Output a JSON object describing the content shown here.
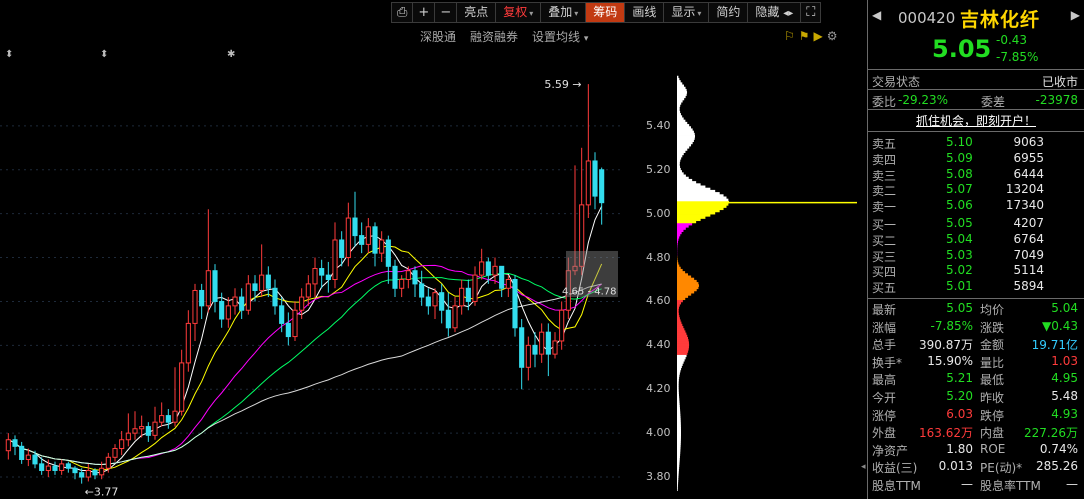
{
  "toolbar": {
    "icons": [
      "lock-icon",
      "plus-icon",
      "minus-icon"
    ],
    "items": [
      {
        "label": "亮点",
        "style": "normal"
      },
      {
        "label": "复权",
        "style": "red",
        "caret": true
      },
      {
        "label": "叠加",
        "style": "normal",
        "caret": true
      },
      {
        "label": "筹码",
        "style": "active"
      },
      {
        "label": "画线",
        "style": "normal"
      },
      {
        "label": "显示",
        "style": "normal",
        "caret": true
      },
      {
        "label": "简约",
        "style": "normal"
      },
      {
        "label": "隐藏",
        "style": "normal"
      }
    ],
    "hide_arrow": "◂▸",
    "fullscreen_icon": "⛶"
  },
  "subbar": {
    "items": [
      "深股通",
      "融资融券",
      "设置均线"
    ],
    "caret": "▾"
  },
  "markers": {
    "glyphs": [
      "⬍",
      "⬍",
      "✱"
    ]
  },
  "chart": {
    "price_ticks": [
      "5.40",
      "5.20",
      "5.00",
      "4.80",
      "4.60",
      "4.40",
      "4.20",
      "4.00",
      "3.80"
    ],
    "high_label": "5.59",
    "low_label": "3.77",
    "cost_label": "4.65 - 4.78",
    "colors": {
      "up": "#ff3b3b",
      "down": "#33ddee",
      "ma5": "#ffffff",
      "ma10": "#ffff00",
      "ma20": "#ff00ff",
      "ma30": "#00ff66",
      "ma60": "#ffffff"
    }
  },
  "chart_data": {
    "type": "candlestick",
    "ylim": [
      3.7,
      5.7
    ],
    "y_ticks": [
      3.8,
      4.0,
      4.2,
      4.4,
      4.6,
      4.8,
      5.0,
      5.2,
      5.4
    ],
    "candles": [
      [
        3.92,
        3.97,
        3.88,
        4.0
      ],
      [
        3.97,
        3.94,
        3.9,
        3.99
      ],
      [
        3.94,
        3.88,
        3.86,
        3.96
      ],
      [
        3.88,
        3.9,
        3.85,
        3.93
      ],
      [
        3.9,
        3.86,
        3.84,
        3.92
      ],
      [
        3.86,
        3.83,
        3.81,
        3.89
      ],
      [
        3.83,
        3.85,
        3.8,
        3.88
      ],
      [
        3.85,
        3.83,
        3.81,
        3.87
      ],
      [
        3.83,
        3.86,
        3.81,
        3.88
      ],
      [
        3.86,
        3.84,
        3.82,
        3.87
      ],
      [
        3.84,
        3.82,
        3.79,
        3.85
      ],
      [
        3.82,
        3.8,
        3.77,
        3.84
      ],
      [
        3.8,
        3.83,
        3.78,
        3.86
      ],
      [
        3.83,
        3.81,
        3.79,
        3.84
      ],
      [
        3.81,
        3.84,
        3.79,
        3.87
      ],
      [
        3.84,
        3.89,
        3.82,
        3.91
      ],
      [
        3.89,
        3.93,
        3.87,
        3.95
      ],
      [
        3.93,
        3.97,
        3.9,
        4.01
      ],
      [
        3.97,
        4.0,
        3.94,
        4.09
      ],
      [
        4.0,
        4.02,
        3.97,
        4.1
      ],
      [
        4.02,
        4.03,
        3.98,
        4.08
      ],
      [
        4.03,
        3.99,
        3.96,
        4.05
      ],
      [
        3.99,
        4.05,
        3.97,
        4.12
      ],
      [
        4.05,
        4.08,
        4.03,
        4.14
      ],
      [
        4.08,
        4.05,
        4.02,
        4.11
      ],
      [
        4.05,
        4.1,
        4.03,
        4.3
      ],
      [
        4.1,
        4.32,
        4.08,
        4.38
      ],
      [
        4.32,
        4.5,
        4.28,
        4.56
      ],
      [
        4.5,
        4.65,
        4.42,
        4.68
      ],
      [
        4.65,
        4.58,
        4.52,
        4.68
      ],
      [
        4.58,
        4.74,
        4.55,
        5.02
      ],
      [
        4.74,
        4.6,
        4.55,
        4.77
      ],
      [
        4.6,
        4.52,
        4.48,
        4.64
      ],
      [
        4.52,
        4.58,
        4.48,
        4.62
      ],
      [
        4.58,
        4.62,
        4.54,
        4.66
      ],
      [
        4.62,
        4.56,
        4.52,
        4.66
      ],
      [
        4.56,
        4.68,
        4.54,
        4.72
      ],
      [
        4.68,
        4.65,
        4.6,
        4.72
      ],
      [
        4.65,
        4.72,
        4.62,
        4.86
      ],
      [
        4.72,
        4.66,
        4.62,
        4.76
      ],
      [
        4.66,
        4.58,
        4.54,
        4.7
      ],
      [
        4.58,
        4.5,
        4.46,
        4.62
      ],
      [
        4.5,
        4.44,
        4.4,
        4.55
      ],
      [
        4.44,
        4.56,
        4.42,
        4.6
      ],
      [
        4.56,
        4.62,
        4.52,
        4.66
      ],
      [
        4.62,
        4.68,
        4.58,
        4.72
      ],
      [
        4.68,
        4.75,
        4.62,
        4.8
      ],
      [
        4.75,
        4.72,
        4.66,
        4.79
      ],
      [
        4.72,
        4.7,
        4.64,
        4.78
      ],
      [
        4.7,
        4.88,
        4.66,
        4.96
      ],
      [
        4.88,
        4.8,
        4.76,
        4.92
      ],
      [
        4.8,
        4.98,
        4.76,
        5.05
      ],
      [
        4.98,
        4.9,
        4.85,
        5.1
      ],
      [
        4.9,
        4.86,
        4.82,
        4.96
      ],
      [
        4.86,
        4.94,
        4.82,
        4.98
      ],
      [
        4.94,
        4.82,
        4.76,
        4.96
      ],
      [
        4.82,
        4.88,
        4.78,
        4.92
      ],
      [
        4.88,
        4.76,
        4.68,
        4.9
      ],
      [
        4.76,
        4.66,
        4.62,
        4.79
      ],
      [
        4.66,
        4.7,
        4.62,
        4.72
      ],
      [
        4.7,
        4.74,
        4.66,
        4.76
      ],
      [
        4.74,
        4.68,
        4.62,
        4.76
      ],
      [
        4.68,
        4.62,
        4.58,
        4.74
      ],
      [
        4.62,
        4.58,
        4.54,
        4.66
      ],
      [
        4.58,
        4.64,
        4.52,
        4.66
      ],
      [
        4.64,
        4.56,
        4.5,
        4.68
      ],
      [
        4.56,
        4.48,
        4.44,
        4.64
      ],
      [
        4.48,
        4.58,
        4.46,
        4.62
      ],
      [
        4.58,
        4.66,
        4.54,
        4.7
      ],
      [
        4.66,
        4.6,
        4.56,
        4.7
      ],
      [
        4.6,
        4.72,
        4.58,
        4.76
      ],
      [
        4.72,
        4.78,
        4.7,
        4.84
      ],
      [
        4.78,
        4.72,
        4.68,
        4.8
      ],
      [
        4.72,
        4.76,
        4.68,
        4.8
      ],
      [
        4.76,
        4.66,
        4.62,
        4.72
      ],
      [
        4.66,
        4.7,
        4.62,
        4.72
      ],
      [
        4.7,
        4.48,
        4.44,
        4.72
      ],
      [
        4.48,
        4.3,
        4.2,
        4.52
      ],
      [
        4.3,
        4.4,
        4.24,
        4.44
      ],
      [
        4.4,
        4.36,
        4.3,
        4.46
      ],
      [
        4.36,
        4.46,
        4.32,
        4.5
      ],
      [
        4.46,
        4.36,
        4.26,
        4.5
      ],
      [
        4.36,
        4.42,
        4.34,
        4.46
      ],
      [
        4.42,
        4.56,
        4.38,
        4.6
      ],
      [
        4.56,
        4.74,
        4.52,
        4.8
      ],
      [
        4.74,
        4.76,
        4.72,
        5.22
      ],
      [
        4.76,
        5.04,
        4.72,
        5.3
      ],
      [
        5.04,
        5.24,
        4.98,
        5.59
      ],
      [
        5.24,
        5.08,
        5.02,
        5.28
      ],
      [
        5.2,
        5.05,
        4.95,
        5.21
      ]
    ]
  },
  "distribution": {
    "colors": [
      "#ffffff",
      "#ffff00",
      "#ff00ff",
      "#ff3b3b",
      "#ff8800"
    ],
    "current_line": "#ffff00"
  },
  "side_icons": [
    "flag-icon",
    "flag-yellow-icon",
    "flag-play-icon",
    "gear-icon"
  ],
  "panel": {
    "code": "000420",
    "name": "吉林化纤",
    "price": "5.05",
    "change": "-0.43",
    "change_pct": "-7.85%",
    "status_label": "交易状态",
    "status_value": "已收市",
    "ratio_label": "委比",
    "ratio_value": "-29.23%",
    "diff_label": "委差",
    "diff_value": "-23978",
    "open_account": "抓住机会，即刻开户！",
    "asks": [
      {
        "label": "卖五",
        "price": "5.10",
        "vol": "9063"
      },
      {
        "label": "卖四",
        "price": "5.09",
        "vol": "6955"
      },
      {
        "label": "卖三",
        "price": "5.08",
        "vol": "6444"
      },
      {
        "label": "卖二",
        "price": "5.07",
        "vol": "13204"
      },
      {
        "label": "卖一",
        "price": "5.06",
        "vol": "17340"
      }
    ],
    "bids": [
      {
        "label": "买一",
        "price": "5.05",
        "vol": "4207"
      },
      {
        "label": "买二",
        "price": "5.04",
        "vol": "6764"
      },
      {
        "label": "买三",
        "price": "5.03",
        "vol": "7049"
      },
      {
        "label": "买四",
        "price": "5.02",
        "vol": "5114"
      },
      {
        "label": "买五",
        "price": "5.01",
        "vol": "5894"
      }
    ],
    "stats": [
      {
        "k1": "最新",
        "v1": "5.05",
        "c1": "green",
        "k2": "均价",
        "v2": "5.04",
        "c2": "green"
      },
      {
        "k1": "涨幅",
        "v1": "-7.85%",
        "c1": "green",
        "k2": "涨跌",
        "v2": "▼0.43",
        "c2": "green"
      },
      {
        "k1": "总手",
        "v1": "390.87万",
        "c1": "white",
        "k2": "金额",
        "v2": "19.71亿",
        "c2": "cyan"
      },
      {
        "k1": "换手*",
        "v1": "15.90%",
        "c1": "white",
        "k2": "量比",
        "v2": "1.03",
        "c2": "red"
      },
      {
        "k1": "最高",
        "v1": "5.21",
        "c1": "green",
        "k2": "最低",
        "v2": "4.95",
        "c2": "green"
      },
      {
        "k1": "今开",
        "v1": "5.20",
        "c1": "green",
        "k2": "昨收",
        "v2": "5.48",
        "c2": "white"
      },
      {
        "k1": "涨停",
        "v1": "6.03",
        "c1": "red",
        "k2": "跌停",
        "v2": "4.93",
        "c2": "green"
      },
      {
        "k1": "外盘",
        "v1": "163.62万",
        "c1": "red",
        "k2": "内盘",
        "v2": "227.26万",
        "c2": "green"
      },
      {
        "k1": "净资产",
        "v1": "1.80",
        "c1": "white",
        "k2": "ROE",
        "v2": "0.74%",
        "c2": "white"
      },
      {
        "k1": "收益(三)",
        "v1": "0.013",
        "c1": "white",
        "k2": "PE(动)*",
        "v2": "285.26",
        "c2": "white"
      },
      {
        "k1": "股息TTM",
        "v1": "—",
        "c1": "white",
        "k2": "股息率TTM",
        "v2": "—",
        "c2": "white"
      }
    ]
  }
}
